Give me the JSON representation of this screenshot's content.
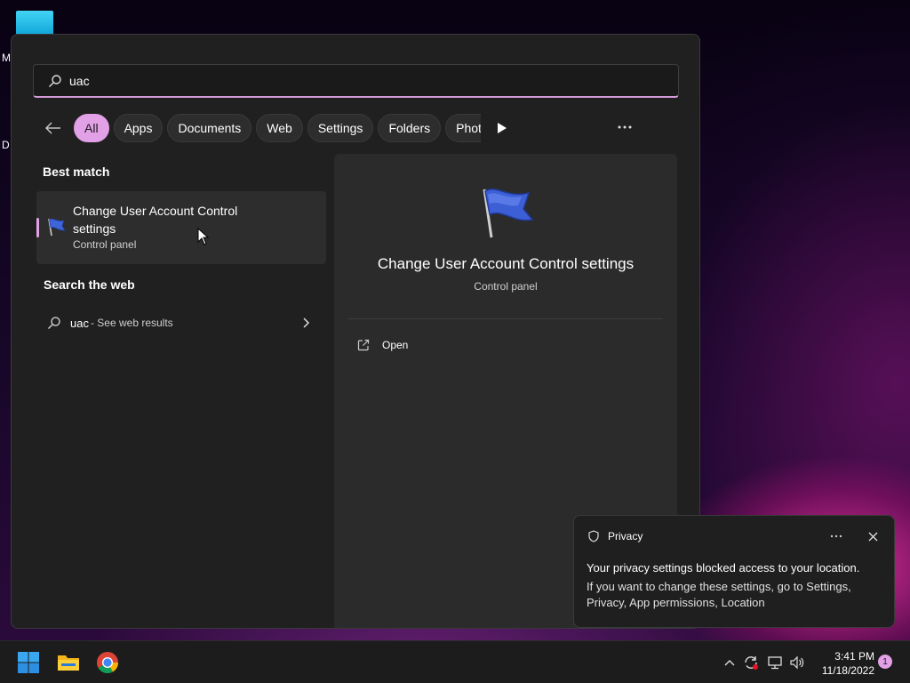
{
  "search": {
    "value": "uac",
    "placeholder": ""
  },
  "filters": {
    "back_icon": "back-arrow-icon",
    "chips": [
      {
        "label": "All",
        "active": true
      },
      {
        "label": "Apps"
      },
      {
        "label": "Documents"
      },
      {
        "label": "Web"
      },
      {
        "label": "Settings"
      },
      {
        "label": "Folders"
      },
      {
        "label": "Phot"
      }
    ],
    "next_icon": "play-icon",
    "more_icon": "more-icon"
  },
  "best_match": {
    "heading": "Best match",
    "title": "Change User Account Control settings",
    "subtitle": "Control panel",
    "icon": "uac-flag-icon"
  },
  "web": {
    "heading": "Search the web",
    "query": "uac",
    "hint": "- See web results"
  },
  "detail": {
    "title": "Change User Account Control settings",
    "subtitle": "Control panel",
    "actions": [
      {
        "label": "Open",
        "icon": "open-external-icon"
      }
    ]
  },
  "desktop": {
    "fragments": [
      "M",
      "D"
    ]
  },
  "notification": {
    "app": "Privacy",
    "title": "Your privacy settings blocked access to your location.",
    "body": "If you want to change these settings, go to Settings, Privacy, App permissions, Location",
    "accent": "#e2a0e6"
  },
  "taskbar": {
    "pinned": [
      "windows-start-icon",
      "file-explorer-icon",
      "chrome-icon"
    ],
    "tray": [
      "chevron-up-icon",
      "sync-icon",
      "network-icon",
      "volume-icon"
    ],
    "time": "3:41 PM",
    "date": "11/18/2022",
    "notification_count": "1"
  },
  "colors": {
    "accent": "#e2a0e6",
    "panel_bg": "#202020",
    "detail_bg": "#2b2b2b",
    "taskbar_bg": "#1c1c1c"
  }
}
